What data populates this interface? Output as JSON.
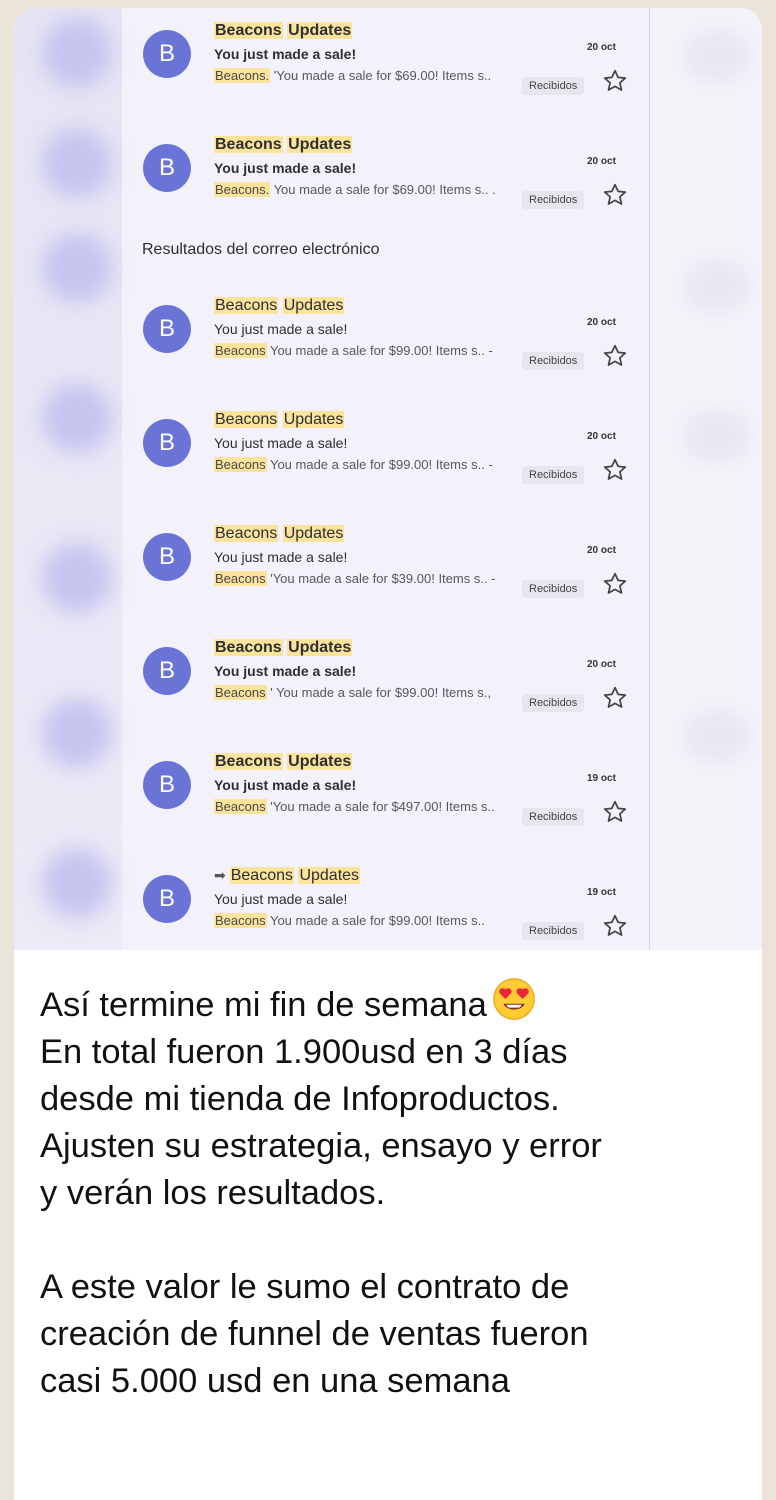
{
  "colors": {
    "avatar": "#6a74d6",
    "highlight": "#fbe39c",
    "chat_background": "#ebe4d8",
    "bubble": "#ffffff"
  },
  "inbox": {
    "section_title": "Resultados del correo electrónico",
    "emails": [
      {
        "avatar_letter": "B",
        "sender_a": "Beacons",
        "sender_b": "Updates",
        "subject": "You just made a sale!",
        "snippet_tag": "Beacons.",
        "snippet": " 'You made a sale for $69.00! Items s..",
        "label": "Recibidos",
        "date": "20 oct",
        "unread": true,
        "forwarded": false
      },
      {
        "avatar_letter": "B",
        "sender_a": "Beacons",
        "sender_b": "Updates",
        "subject": "You just made a sale!",
        "snippet_tag": "Beacons.",
        "snippet": " You made a sale for $69.00! Items s.. .",
        "label": "Recibidos",
        "date": "20 oct",
        "unread": true,
        "forwarded": false
      },
      {
        "avatar_letter": "B",
        "sender_a": "Beacons",
        "sender_b": "Updates",
        "subject": "You just made a sale!",
        "snippet_tag": "Beacons",
        "snippet": " You made a sale for $99.00! Items s.. -",
        "label": "Recibidos",
        "date": "20 oct",
        "unread": false,
        "forwarded": false
      },
      {
        "avatar_letter": "B",
        "sender_a": "Beacons",
        "sender_b": "Updates",
        "subject": "You just made a sale!",
        "snippet_tag": "Beacons",
        "snippet": "  You made a sale for $99.00! Items s.. -",
        "label": "Recibidos",
        "date": "20 oct",
        "unread": false,
        "forwarded": false
      },
      {
        "avatar_letter": "B",
        "sender_a": "Beacons",
        "sender_b": "Updates",
        "subject": "You just made a sale!",
        "snippet_tag": "Beacons",
        "snippet": " 'You made a sale for $39.00! Items s.. -",
        "label": "Recibidos",
        "date": "20 oct",
        "unread": false,
        "forwarded": false
      },
      {
        "avatar_letter": "B",
        "sender_a": "Beacons",
        "sender_b": "Updates",
        "subject": "You just made a sale!",
        "snippet_tag": "Beacons",
        "snippet": " ' You made a sale for $99.00! Items s.,",
        "label": "Recibidos",
        "date": "20 oct",
        "unread": true,
        "forwarded": false
      },
      {
        "avatar_letter": "B",
        "sender_a": "Beacons",
        "sender_b": "Updates",
        "subject": "You just made a sale!",
        "snippet_tag": "Beacons",
        "snippet": " 'You made a sale for $497.00! Items s..",
        "label": "Recibidos",
        "date": "19 oct",
        "unread": true,
        "forwarded": false
      },
      {
        "avatar_letter": "B",
        "sender_a": "Beacons",
        "sender_b": "Updates",
        "subject": "You just made a sale!",
        "snippet_tag": "Beacons",
        "snippet": " You made a sale for $99.00! Items s..",
        "label": "Recibidos",
        "date": "19 oct",
        "unread": false,
        "forwarded": true
      }
    ]
  },
  "message": {
    "line1": "Así termine mi fin de semana",
    "emoji": "smiling-face-with-heart-eyes",
    "line2": "En total fueron 1.900usd en 3 días",
    "line3": "desde mi tienda de Infoproductos.",
    "line4": "Ajusten su estrategia, ensayo y error",
    "line5": "y verán los resultados.",
    "line6": "A este valor le sumo el contrato de",
    "line7": "creación de funnel de ventas fueron",
    "line8": "casi 5.000 usd en una semana"
  }
}
